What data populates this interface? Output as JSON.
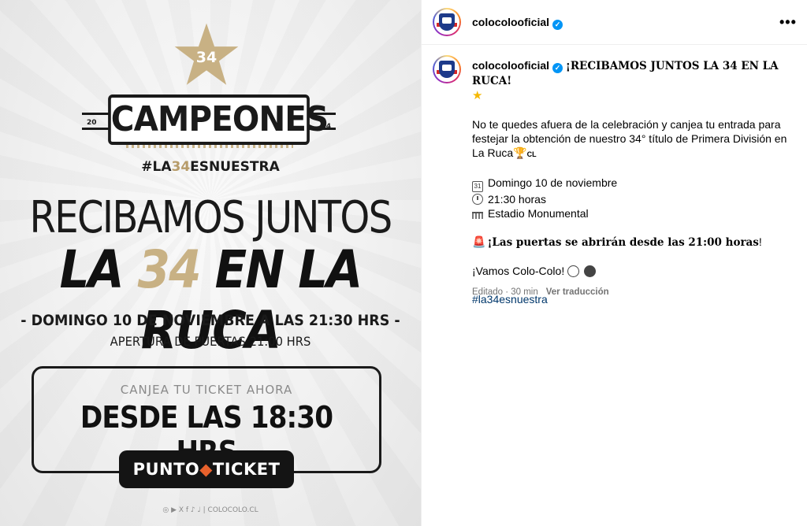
{
  "poster": {
    "star_number": "34",
    "campeones": "CAMPEONES",
    "year_left": "20",
    "year_right": "24",
    "hashtag_a": "#LA",
    "hashtag_b": "34",
    "hashtag_c": "ESNUESTRA",
    "headline_line1": "RECIBAMOS JUNTOS",
    "headline_line2_a": "LA ",
    "headline_line2_b": "34",
    "headline_line2_c": " EN LA RUCA",
    "date_line": "- DOMINGO 10 DE NOVIEMBRE A LAS 21:30 HRS -",
    "doors_line": "APERTURA DE PUERTAS 21:00 HRS",
    "ticket_label": "CANJEA TU TICKET AHORA",
    "ticket_time": "DESDE LAS 18:30 HRS",
    "puntoticket_a": "PUNTO",
    "puntoticket_b": "TICKET",
    "footer": "◎ ▶ X f ♪ ♩ | COLOCOLO.CL"
  },
  "header": {
    "username": "colocolooficial",
    "verified_glyph": "✓",
    "more_glyph": "•••"
  },
  "caption": {
    "username": "colocolooficial",
    "title": "¡RECIBAMOS JUNTOS LA 34 EN LA RUCA!",
    "star_emoji": "★",
    "body": "No te quedes afuera de la celebración y canjea tu entrada para festejar la obtención de nuestro 34° título de Primera División en La Ruca",
    "trophy_emoji": "🏆",
    "flag": "CL",
    "calendar_glyph": "31",
    "date": "Domingo 10 de noviembre",
    "time": "21:30 horas",
    "venue": "Estadio Monumental",
    "siren_emoji": "🚨",
    "doors": "¡Las puertas se abrirán desde las 21:00 horas",
    "doors_end": "!",
    "cheer": "¡Vamos Colo-Colo!",
    "hashtag": "#la34esnuestra"
  },
  "meta": {
    "edited": "Editado · 30 min",
    "translate": "Ver traducción"
  }
}
